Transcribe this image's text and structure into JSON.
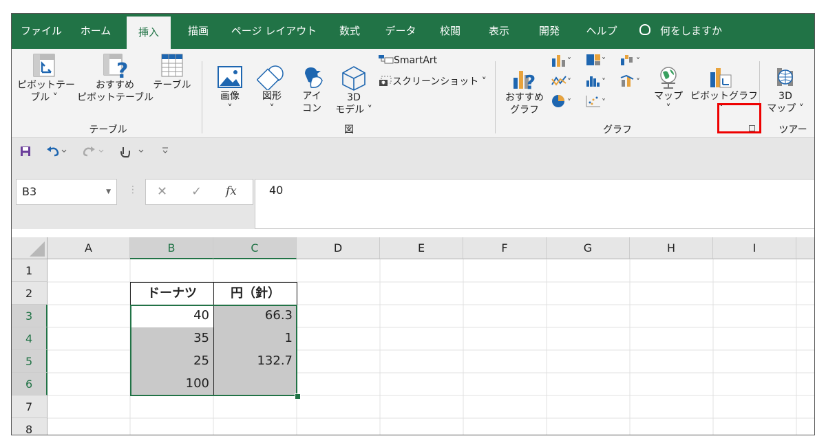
{
  "tabs": [
    {
      "label": "ファイル"
    },
    {
      "label": "ホーム"
    },
    {
      "label": "挿入"
    },
    {
      "label": "描画"
    },
    {
      "label": "ページ レイアウト"
    },
    {
      "label": "数式"
    },
    {
      "label": "データ"
    },
    {
      "label": "校閲"
    },
    {
      "label": "表示"
    },
    {
      "label": "開発"
    },
    {
      "label": "ヘルプ"
    }
  ],
  "tell_me": "何をしますか",
  "ribbon": {
    "pivot_table": {
      "line1": "ピボットテー",
      "line2": "ブル ˅"
    },
    "recommended_pivot": {
      "line1": "おすすめ",
      "line2": "ピボットテーブル"
    },
    "table": {
      "line1": "テーブル"
    },
    "group_tables": "テーブル",
    "image": {
      "line1": "画像",
      "line2": "˅"
    },
    "shapes": {
      "line1": "図形",
      "line2": "˅"
    },
    "icons": {
      "line1": "アイ",
      "line2": "コン"
    },
    "model3d": {
      "line1": "3D",
      "line2": "モデル ˅"
    },
    "smartart": "SmartArt",
    "screenshot": "スクリーンショット ˅",
    "group_illustrations": "図",
    "recommended_charts": {
      "line1": "おすすめ",
      "line2": "グラフ"
    },
    "maps": {
      "line1": "マップ",
      "line2": "˅"
    },
    "pivot_chart": {
      "line1": "ピボットグラフ",
      "line2": "˅"
    },
    "group_charts": "グラフ",
    "map3d": {
      "line1": "3D",
      "line2": "マップ ˅"
    },
    "group_tours": "ツアー"
  },
  "formula_bar": {
    "name_box": "B3",
    "cancel": "✕",
    "enter": "✓",
    "fx": "fx",
    "value": "40"
  },
  "columns": [
    "A",
    "B",
    "C",
    "D",
    "E",
    "F",
    "G",
    "H",
    "I"
  ],
  "rows": [
    "1",
    "2",
    "3",
    "4",
    "5",
    "6",
    "7",
    "8"
  ],
  "table": {
    "header_b": "ドーナツ",
    "header_c": "円（針）",
    "b_values": [
      "40",
      "35",
      "25",
      "100"
    ],
    "c_values": [
      "66.3",
      "1",
      "132.7",
      ""
    ]
  },
  "colors": {
    "accent": "#217346",
    "highlight": "#e00000"
  }
}
